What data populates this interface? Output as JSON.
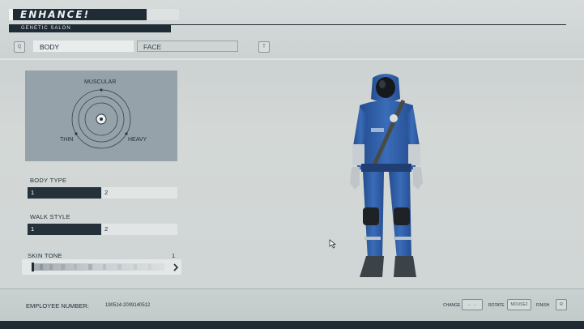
{
  "header": {
    "logo": "ENHANCE!",
    "subtitle": "GENETIC SALON",
    "left_key": "Q",
    "right_key": "T"
  },
  "tabs": [
    {
      "label": "BODY",
      "active": true
    },
    {
      "label": "FACE",
      "active": false
    }
  ],
  "body_shape": {
    "top_label": "MUSCULAR",
    "left_label": "THIN",
    "right_label": "HEAVY"
  },
  "body_type": {
    "label": "BODY TYPE",
    "options": [
      "1",
      "2"
    ],
    "selected": "1"
  },
  "walk_style": {
    "label": "WALK STYLE",
    "options": [
      "1",
      "2"
    ],
    "selected": "1"
  },
  "skin_tone": {
    "label": "SKIN TONE",
    "value": "1",
    "next_icon": "chevron-right-icon"
  },
  "footer": {
    "employee_label": "EMPLOYEE NUMBER:",
    "employee_number": "190514-2009140512",
    "hints": [
      {
        "label": "CHANGE",
        "key": "← →"
      },
      {
        "label": "ROTATE",
        "key": "MOUSE2"
      },
      {
        "label": "FINISH",
        "key": "R"
      }
    ]
  },
  "colors": {
    "dark_navy": "#1f2b35",
    "panel": "#95a2aa",
    "suit_blue": "#2f5fa8"
  }
}
